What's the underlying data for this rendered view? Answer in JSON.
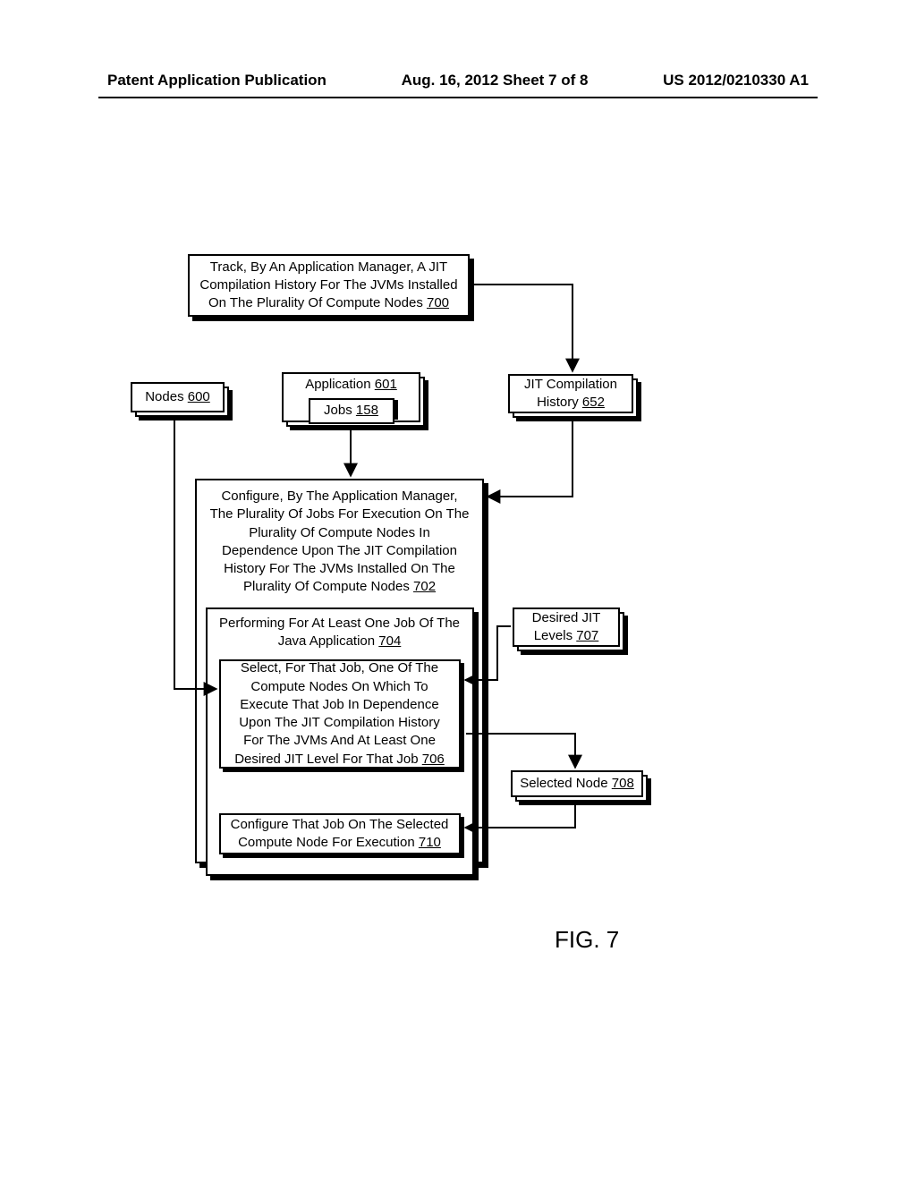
{
  "header": {
    "left": "Patent Application Publication",
    "center": "Aug. 16, 2012  Sheet 7 of 8",
    "right": "US 2012/0210330 A1"
  },
  "boxes": {
    "track": {
      "text": "Track, By An Application Manager, A JIT Compilation History For The JVMs Installed On The Plurality Of Compute Nodes ",
      "ref": "700"
    },
    "nodes": {
      "label": "Nodes ",
      "ref": "600"
    },
    "application": {
      "label": "Application ",
      "ref": "601"
    },
    "jobs": {
      "label": "Jobs ",
      "ref": "158"
    },
    "jit_history": {
      "label": "JIT Compilation History ",
      "ref": "652"
    },
    "configure": {
      "text": "Configure, By The Application Manager, The Plurality Of Jobs For Execution On The Plurality Of Compute Nodes In Dependence Upon The JIT Compilation History For The JVMs Installed On The Plurality Of Compute Nodes ",
      "ref": "702"
    },
    "performing": {
      "text": "Performing For At Least One Job Of The Java Application ",
      "ref": "704"
    },
    "select": {
      "text": "Select, For That Job, One Of The Compute Nodes On Which To Execute That Job In Dependence Upon The JIT Compilation History For The JVMs And At Least One Desired JIT Level For That Job ",
      "ref": "706"
    },
    "desired_jit": {
      "label": "Desired JIT Levels ",
      "ref": "707"
    },
    "selected_node": {
      "label": "Selected Node ",
      "ref": "708"
    },
    "configure_job": {
      "text": "Configure That Job On The Selected Compute Node For Execution ",
      "ref": "710"
    }
  },
  "figure_label": "FIG. 7"
}
